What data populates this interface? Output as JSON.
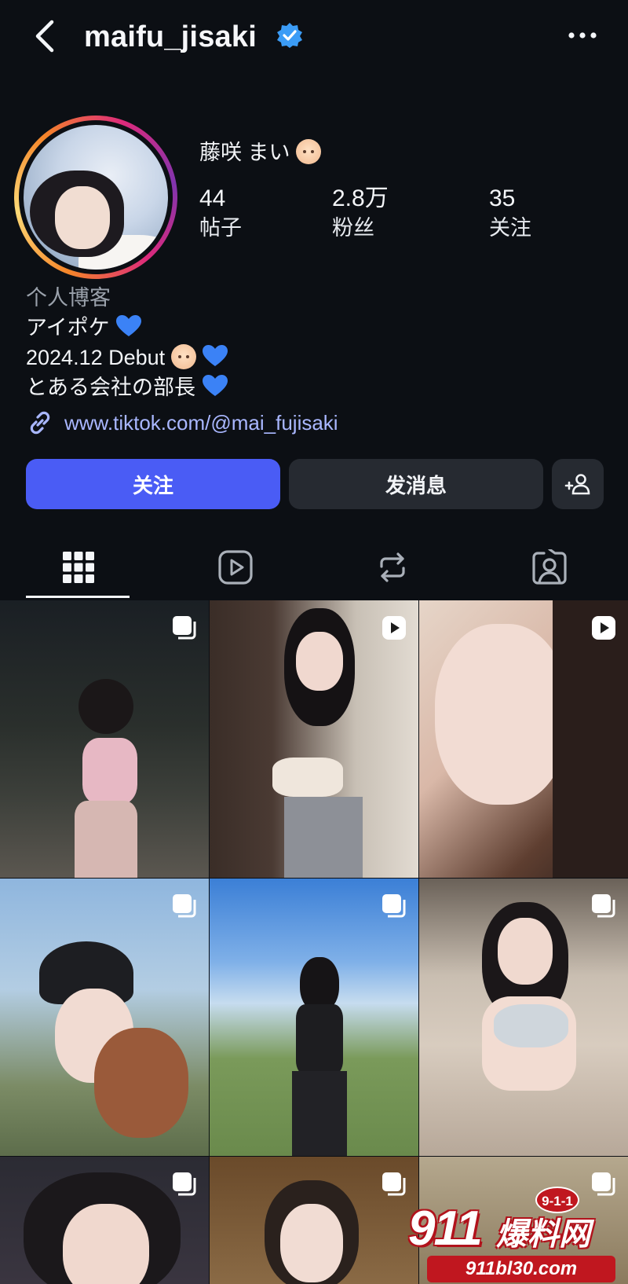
{
  "header": {
    "username": "maifu_jisaki",
    "back_icon": "chevron-left-icon",
    "verified_icon": "verified-badge-icon",
    "more_icon": "more-horizontal-icon"
  },
  "profile": {
    "display_name": "藤咲 まい"
  },
  "stats": [
    {
      "value": "44",
      "label": "帖子"
    },
    {
      "value": "2.8万",
      "label": "粉丝"
    },
    {
      "value": "35",
      "label": "关注"
    }
  ],
  "bio": {
    "category": "个人博客",
    "line1": "アイポケ",
    "line2": "2024.12 Debut",
    "line3": "とある会社の部長"
  },
  "link": {
    "text": "www.tiktok.com/@mai_fujisaki"
  },
  "actions": {
    "follow": "关注",
    "message": "发消息"
  },
  "tabs": [
    "grid-icon",
    "reels-icon",
    "reposts-icon",
    "tagged-icon"
  ],
  "watermark": {
    "big": "911",
    "cn": "爆料网",
    "badge": "9-1-1",
    "url": "911bl30.com"
  },
  "colors": {
    "background": "#0c0f14",
    "accent": "#4a5cf5",
    "link": "#a9b7ff",
    "heart": "#3b82f6"
  }
}
